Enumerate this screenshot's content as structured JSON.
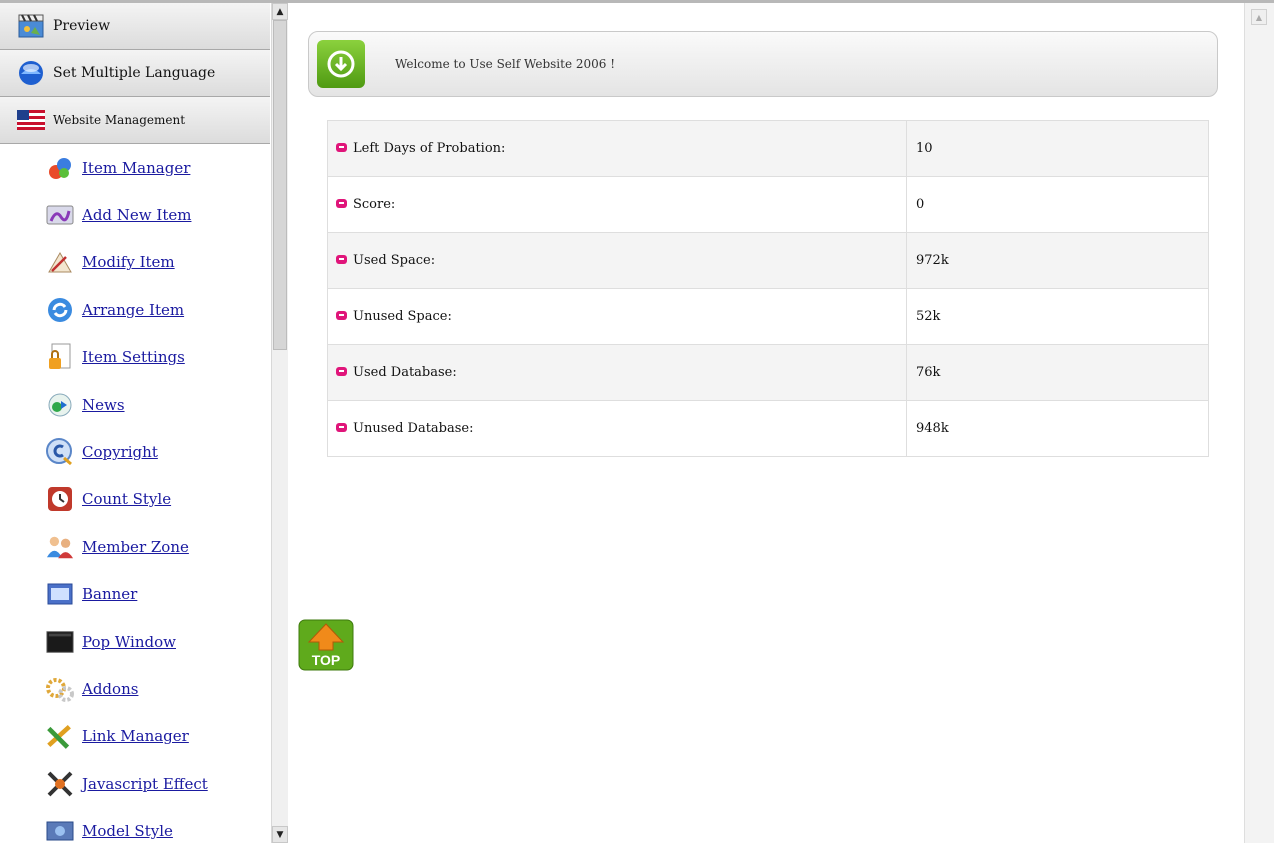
{
  "sidebar": {
    "headers": [
      {
        "label": "Preview",
        "icon": "clapperboard-icon"
      },
      {
        "label": "Set Multiple Language",
        "icon": "globe-icon"
      },
      {
        "label": "Website Management",
        "icon": "us-flag-icon"
      }
    ],
    "items": [
      {
        "label": "Item Manager",
        "icon": "shapes-icon"
      },
      {
        "label": "Add New Item",
        "icon": "video-clip-icon"
      },
      {
        "label": "Modify Item",
        "icon": "drawing-icon"
      },
      {
        "label": "Arrange Item",
        "icon": "refresh-icon"
      },
      {
        "label": "Item Settings",
        "icon": "document-lock-icon"
      },
      {
        "label": "News",
        "icon": "news-icon"
      },
      {
        "label": "Copyright",
        "icon": "copyright-icon"
      },
      {
        "label": "Count Style",
        "icon": "clock-icon"
      },
      {
        "label": "Member Zone",
        "icon": "members-icon"
      },
      {
        "label": "Banner",
        "icon": "banner-icon"
      },
      {
        "label": "Pop Window",
        "icon": "window-icon"
      },
      {
        "label": "Addons",
        "icon": "gears-icon"
      },
      {
        "label": "Link Manager",
        "icon": "link-icon"
      },
      {
        "label": "Javascript Effect",
        "icon": "effect-icon"
      },
      {
        "label": "Model Style",
        "icon": "model-icon"
      }
    ]
  },
  "main": {
    "welcome": "Welcome to Use Self Website 2006 !",
    "stats": [
      {
        "label": "Left Days of Probation:",
        "value": "10"
      },
      {
        "label": "Score:",
        "value": "0"
      },
      {
        "label": "Used Space:",
        "value": "972k"
      },
      {
        "label": "Unused Space:",
        "value": "52k"
      },
      {
        "label": "Used Database:",
        "value": "76k"
      },
      {
        "label": "Unused Database:",
        "value": "948k"
      }
    ],
    "top_button_label": "TOP"
  },
  "colors": {
    "link": "#1a1aa0",
    "bullet": "#e0157a",
    "accent_green": "#5faa1c",
    "top_orange": "#f08a1a"
  }
}
